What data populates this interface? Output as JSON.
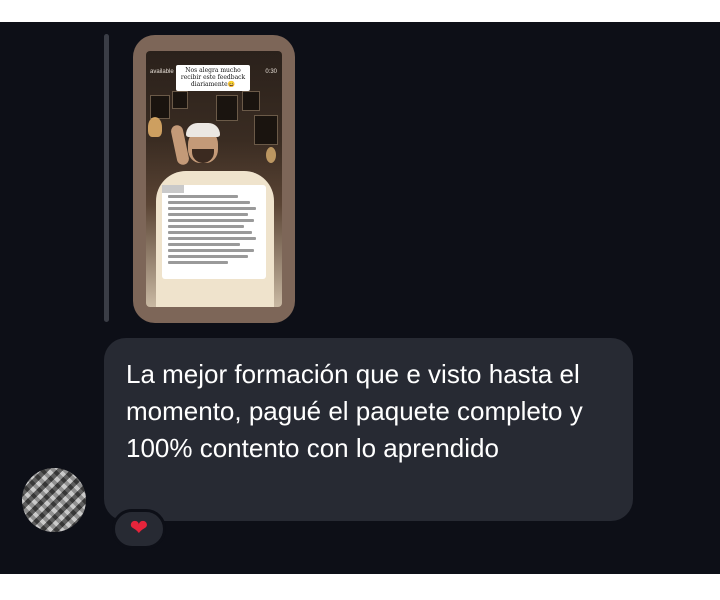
{
  "story_preview": {
    "username": "available",
    "time": "0:30",
    "caption": "Nos alegra mucho recibir este feedback diariamente😄"
  },
  "message": {
    "text": "La mejor formación que e visto hasta el momento, pagué el paquete completo y 100% contento con lo aprendido"
  },
  "reaction": {
    "emoji": "❤"
  },
  "colors": {
    "chat_background": "#0d0f17",
    "bubble": "#272a33",
    "reaction_heart": "#e5243b"
  },
  "icons": {
    "avatar": "blurred-avatar",
    "reaction": "heart-icon"
  }
}
